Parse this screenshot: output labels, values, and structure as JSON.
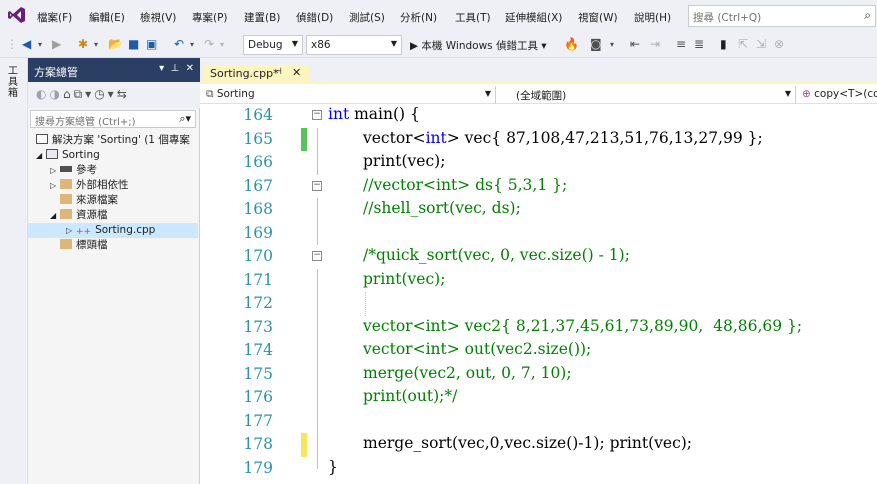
{
  "menu": [
    "檔案(F)",
    "編輯(E)",
    "檢視(V)",
    "專案(P)",
    "建置(B)",
    "偵錯(D)",
    "測試(S)",
    "分析(N)",
    "工具(T)",
    "延伸模組(X)",
    "視窗(W)",
    "說明(H)"
  ],
  "search": {
    "placeholder": "搜尋 (Ctrl+Q)"
  },
  "toolbar": {
    "config": "Debug",
    "platform": "x86",
    "run_label": "▶ 本機 Windows 偵錯工具 ▾"
  },
  "side_strip_label": "工具箱",
  "solution_panel": {
    "title": "方案總管",
    "search_placeholder": "搜尋方案總管 (Ctrl+;)",
    "items": [
      {
        "label": "解決方案 'Sorting' (1 個專案"
      },
      {
        "label": "Sorting"
      },
      {
        "label": "參考"
      },
      {
        "label": "外部相依性"
      },
      {
        "label": "來源檔案"
      },
      {
        "label": "資源檔"
      },
      {
        "label": "Sorting.cpp"
      },
      {
        "label": "標頭檔"
      }
    ]
  },
  "editor": {
    "tab": {
      "label": "Sorting.cpp*"
    },
    "nav": {
      "project": "Sorting",
      "scope": "(全域範圍)",
      "member": "copy<T>(cons"
    },
    "lines": [
      {
        "num": "164"
      },
      {
        "num": "165"
      },
      {
        "num": "166"
      },
      {
        "num": "167"
      },
      {
        "num": "168"
      },
      {
        "num": "169"
      },
      {
        "num": "170"
      },
      {
        "num": "171"
      },
      {
        "num": "172"
      },
      {
        "num": "173"
      },
      {
        "num": "174"
      },
      {
        "num": "175"
      },
      {
        "num": "176"
      },
      {
        "num": "177"
      },
      {
        "num": "178"
      },
      {
        "num": "179"
      }
    ],
    "code": {
      "l164_kw": "int",
      "l164_rest": " main() {",
      "l165_kw": "int",
      "l165_pre": "vector<",
      "l165_rest": "> vec{ 87,108,47,213,51,76,13,27,99 };",
      "l166": "print(vec);",
      "l167": "//vector<int> ds{ 5,3,1 };",
      "l168": "//shell_sort(vec, ds);",
      "l170": "/*quick_sort(vec, 0, vec.size() - 1);",
      "l171": "print(vec);",
      "l173": "vector<int> vec2{ 8,21,37,45,61,73,89,90,  48,86,69 };",
      "l174": "vector<int> out(vec2.size());",
      "l175": "merge(vec2, out, 0, 7, 10);",
      "l176": "print(out);*/",
      "l178": "merge_sort(vec,0,vec.size()-1); print(vec);",
      "l179": "}"
    }
  },
  "colors": {
    "accent": "#68217a",
    "title_bar": "#2b3e63",
    "tab_active": "#fdf4bf",
    "change_saved": "#57c35d",
    "change_unsaved": "#f5e65b",
    "line_number": "#2b91af",
    "keyword": "#0000ff",
    "comment": "#008000"
  }
}
